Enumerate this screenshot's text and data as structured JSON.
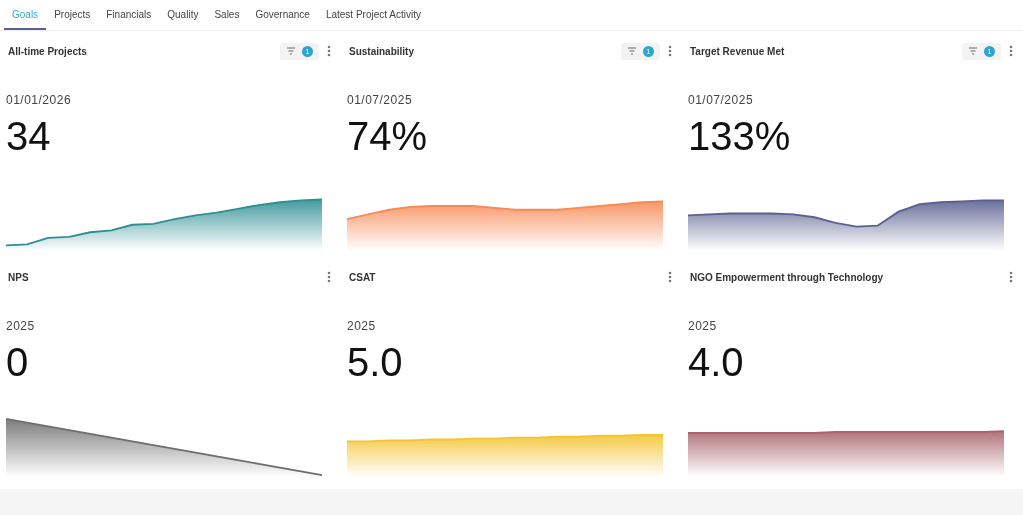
{
  "tabs": [
    {
      "label": "Goals",
      "selected": true
    },
    {
      "label": "Projects",
      "selected": false
    },
    {
      "label": "Financials",
      "selected": false
    },
    {
      "label": "Quality",
      "selected": false
    },
    {
      "label": "Sales",
      "selected": false
    },
    {
      "label": "Governance",
      "selected": false
    },
    {
      "label": "Latest Project Activity",
      "selected": false
    }
  ],
  "cards": [
    {
      "title": "All-time Projects",
      "filter_count": "1",
      "date": "01/01/2026",
      "value": "34",
      "color": "#2e8f93"
    },
    {
      "title": "Sustainability",
      "filter_count": "1",
      "date": "01/07/2025",
      "value": "74%",
      "color": "#f78a55"
    },
    {
      "title": "Target Revenue Met",
      "filter_count": "1",
      "date": "01/07/2025",
      "value": "133%",
      "color": "#5a6190"
    },
    {
      "title": "NPS",
      "date": "2025",
      "value": "0",
      "color": "#6e6e6e"
    },
    {
      "title": "CSAT",
      "date": "2025",
      "value": "5.0",
      "color": "#f4c431"
    },
    {
      "title": "NGO Empowerment through Technology",
      "date": "2025",
      "value": "4.0",
      "color": "#a8636b"
    }
  ]
}
